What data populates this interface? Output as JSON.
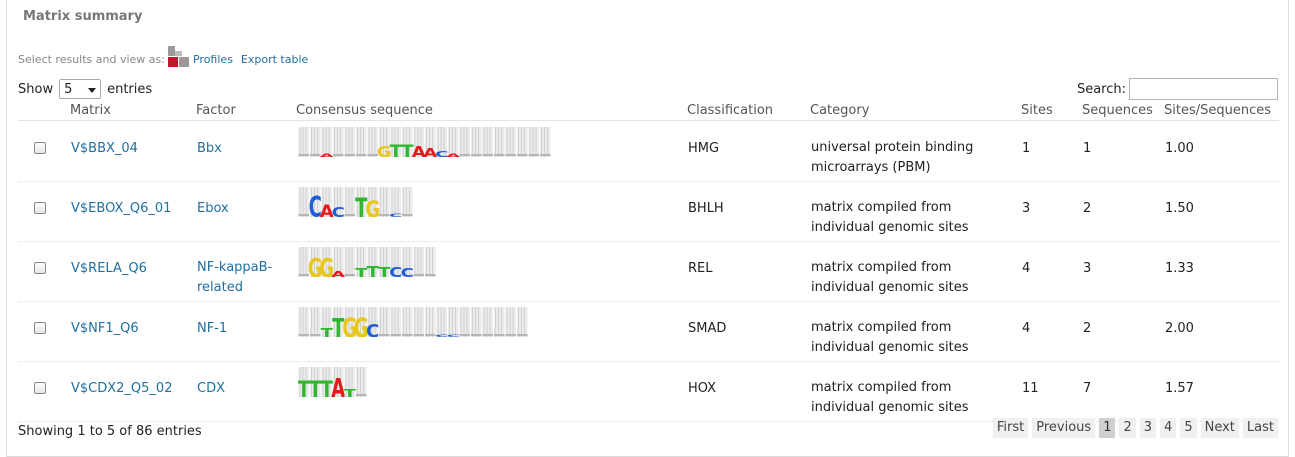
{
  "panel": {
    "title": "Matrix summary"
  },
  "view_as": {
    "label": "Select results and view as:",
    "profiles": "Profiles",
    "export": "Export table"
  },
  "length": {
    "show": "Show",
    "value": "5",
    "entries": "entries"
  },
  "search": {
    "label": "Search:",
    "value": ""
  },
  "columns": {
    "matrix": "Matrix",
    "factor": "Factor",
    "consensus": "Consensus sequence",
    "classification": "Classification",
    "category": "Category",
    "sites": "Sites",
    "sequences": "Sequences",
    "ratio": "Sites/Sequences"
  },
  "rows": [
    {
      "matrix": "V$BBX_04",
      "factor": [
        "Bbx"
      ],
      "classification": "HMG",
      "category": [
        "universal protein binding",
        "microarrays (PBM)"
      ],
      "sites": "1",
      "sequences": "1",
      "ratio": "1.00",
      "logo": [
        [
          "",
          0.12
        ],
        [
          "",
          0.12
        ],
        [
          "A",
          0.15
        ],
        [
          "",
          0.12
        ],
        [
          "",
          0.12
        ],
        [
          "",
          0.12
        ],
        [
          "",
          0.12
        ],
        [
          "G",
          0.5
        ],
        [
          "T",
          0.55
        ],
        [
          "T",
          0.55
        ],
        [
          "A",
          0.5
        ],
        [
          "A",
          0.4
        ],
        [
          "C",
          0.25
        ],
        [
          "A",
          0.15
        ],
        [
          "",
          0.12
        ],
        [
          "",
          0.12
        ],
        [
          "",
          0.12
        ],
        [
          "",
          0.12
        ],
        [
          "",
          0.12
        ],
        [
          "",
          0.12
        ],
        [
          "",
          0.12
        ],
        [
          "",
          0.12
        ]
      ]
    },
    {
      "matrix": "V$EBOX_Q6_01",
      "factor": [
        "Ebox"
      ],
      "classification": "BHLH",
      "category": [
        "matrix compiled from",
        "individual genomic sites"
      ],
      "sites": "3",
      "sequences": "2",
      "ratio": "1.50",
      "logo": [
        [
          "",
          0.12
        ],
        [
          "C",
          0.95
        ],
        [
          "A",
          0.55
        ],
        [
          "C",
          0.45
        ],
        [
          "",
          0.12
        ],
        [
          "T",
          0.9
        ],
        [
          "G",
          0.75
        ],
        [
          "",
          0.12
        ],
        [
          "C",
          0.15
        ],
        [
          "",
          0.12
        ]
      ]
    },
    {
      "matrix": "V$RELA_Q6",
      "factor": [
        "NF-kappaB-",
        "related"
      ],
      "classification": "REL",
      "category": [
        "matrix compiled from",
        "individual genomic sites"
      ],
      "sites": "4",
      "sequences": "3",
      "ratio": "1.33",
      "logo": [
        [
          "",
          0.15
        ],
        [
          "G",
          0.85
        ],
        [
          "G",
          0.85
        ],
        [
          "A",
          0.25
        ],
        [
          "",
          0.12
        ],
        [
          "T",
          0.4
        ],
        [
          "T",
          0.5
        ],
        [
          "T",
          0.45
        ],
        [
          "C",
          0.45
        ],
        [
          "C",
          0.4
        ],
        [
          "",
          0.12
        ],
        [
          "",
          0.12
        ]
      ]
    },
    {
      "matrix": "V$NF1_Q6",
      "factor": [
        "NF-1"
      ],
      "classification": "SMAD",
      "category": [
        "matrix compiled from",
        "individual genomic sites"
      ],
      "sites": "4",
      "sequences": "2",
      "ratio": "2.00",
      "logo": [
        [
          "",
          0.12
        ],
        [
          "",
          0.12
        ],
        [
          "T",
          0.4
        ],
        [
          "T",
          0.85
        ],
        [
          "G",
          0.9
        ],
        [
          "G",
          0.9
        ],
        [
          "C",
          0.6
        ],
        [
          "",
          0.12
        ],
        [
          "",
          0.12
        ],
        [
          "",
          0.12
        ],
        [
          "",
          0.12
        ],
        [
          "",
          0.12
        ],
        [
          "C",
          0.12
        ],
        [
          "C",
          0.12
        ],
        [
          "",
          0.12
        ],
        [
          "",
          0.12
        ],
        [
          "",
          0.12
        ],
        [
          "",
          0.12
        ],
        [
          "",
          0.12
        ],
        [
          "",
          0.12
        ]
      ]
    },
    {
      "matrix": "V$CDX2_Q5_02",
      "factor": [
        "CDX"
      ],
      "classification": "HOX",
      "category": [
        "matrix compiled from",
        "individual genomic sites"
      ],
      "sites": "11",
      "sequences": "7",
      "ratio": "1.57",
      "logo": [
        [
          "T",
          0.75
        ],
        [
          "T",
          0.75
        ],
        [
          "T",
          0.75
        ],
        [
          "A",
          0.85
        ],
        [
          "T",
          0.35
        ],
        [
          "",
          0.12
        ]
      ]
    }
  ],
  "info": "Showing 1 to 5 of 86 entries",
  "pager": {
    "first": "First",
    "previous": "Previous",
    "pages": [
      "1",
      "2",
      "3",
      "4",
      "5"
    ],
    "next": "Next",
    "last": "Last",
    "active": "1"
  },
  "colors": {
    "link": "#1f6fa0",
    "A": "#e41a1c",
    "C": "#1f5fd6",
    "G": "#e8c71c",
    "T": "#2fb82f"
  }
}
